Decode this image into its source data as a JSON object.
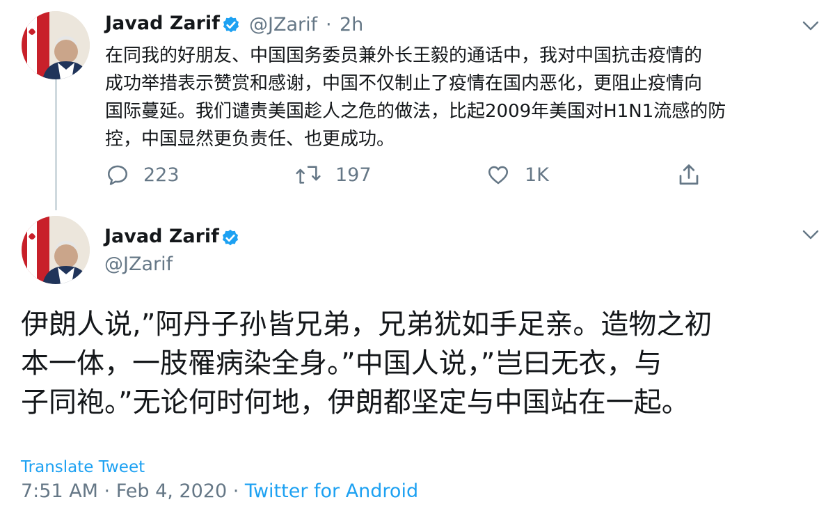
{
  "tweet1": {
    "display_name": "Javad Zarif",
    "handle": "@JZarif",
    "separator": "·",
    "time_ago": "2h",
    "text_lines": [
      "在同我的好朋友、中国国务委员兼外长王毅的通话中，我对中国抗击疫情的",
      "成功举措表示赞赏和感谢，中国不仅制止了疫情在国内恶化，更阻止疫情向",
      "国际蔓延。我们谴责美国趁人之危的做法，比起2009年美国对H1N1流感的防",
      "控，中国显然更负责任、也更成功。"
    ],
    "replies": "223",
    "retweets": "197",
    "likes": "1K"
  },
  "tweet2": {
    "display_name": "Javad Zarif",
    "handle": "@JZarif",
    "text_lines": [
      "伊朗人说,”阿丹子孙皆兄弟，兄弟犹如手足亲。造物之初",
      "本一体，一肢罹病染全身。”中国人说，”岂曰无衣，与",
      "子同袍。”无论何时何地，伊朗都坚定与中国站在一起。"
    ],
    "translate_label": "Translate Tweet",
    "timestamp": "7:51 AM · Feb 4, 2020 · ",
    "source": "Twitter for Android"
  },
  "colors": {
    "accent": "#1da1f2",
    "secondary_text": "#657786",
    "primary_text": "#14171a",
    "thread_line": "#cfd9de"
  },
  "icons": {
    "reply": "reply-icon",
    "retweet": "retweet-icon",
    "like": "heart-icon",
    "share": "share-icon",
    "verified": "verified-badge-icon",
    "more": "chevron-down-icon"
  }
}
